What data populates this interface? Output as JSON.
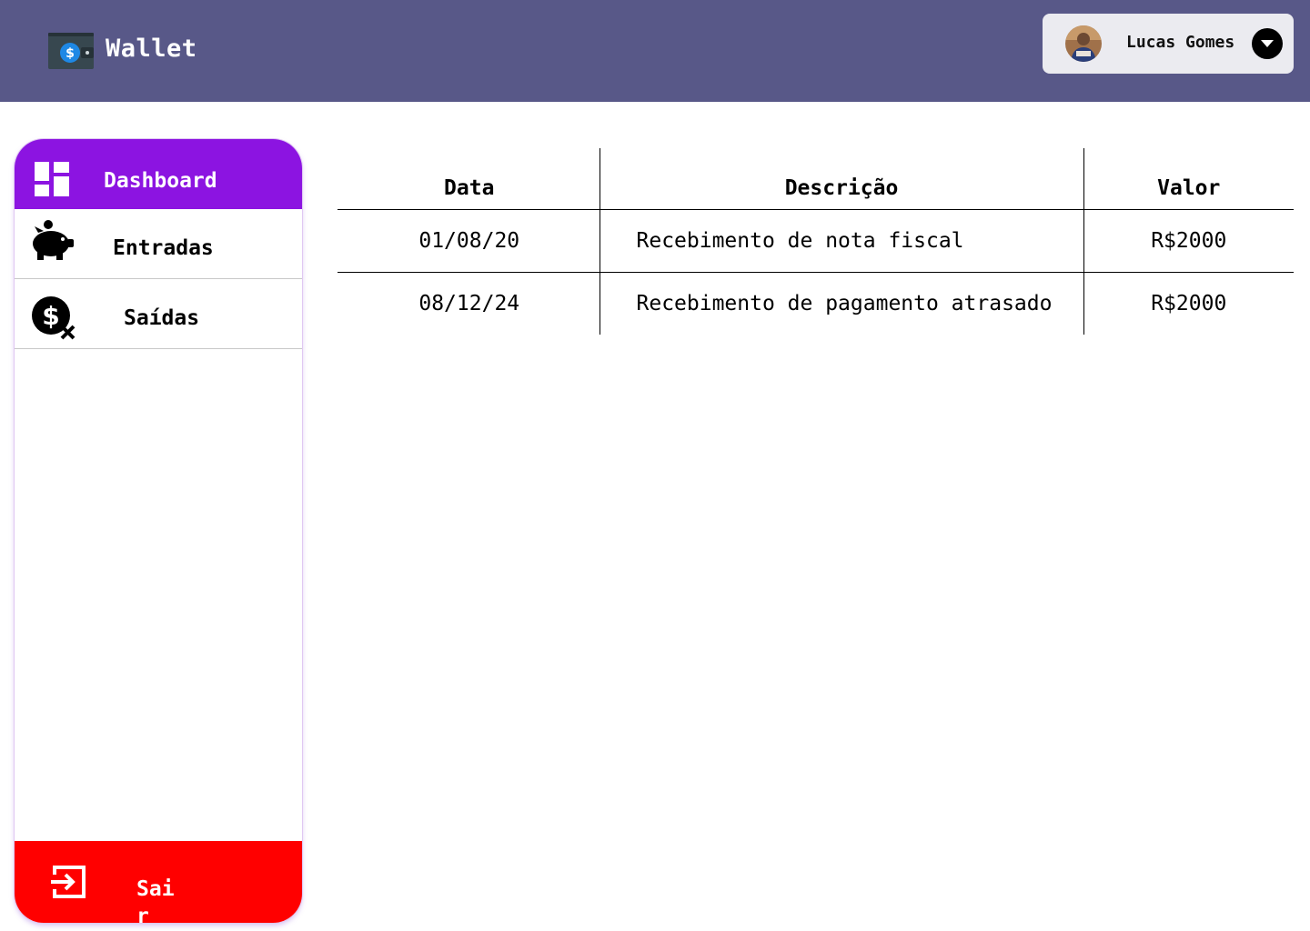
{
  "header": {
    "app_title": "Wallet",
    "logo_icon": "wallet-icon",
    "background": "#585888",
    "user": {
      "name": "Lucas Gomes",
      "avatar_icon": "user-avatar",
      "dropdown_icon": "chevron-down-icon"
    }
  },
  "sidebar": {
    "accent": "#8c14e1",
    "items": [
      {
        "label": "Dashboard",
        "icon": "dashboard-icon",
        "active": true
      },
      {
        "label": "Entradas",
        "icon": "piggy-bank-icon",
        "active": false
      },
      {
        "label": "Saídas",
        "icon": "money-off-icon",
        "active": false
      }
    ],
    "logout": {
      "label": "Sair",
      "icon": "exit-icon",
      "color": "#ff0000"
    }
  },
  "table": {
    "columns": [
      "Data",
      "Descrição",
      "Valor"
    ],
    "rows": [
      {
        "data": "01/08/20",
        "descricao": "Recebimento de nota fiscal",
        "valor": "R$2000"
      },
      {
        "data": "08/12/24",
        "descricao": "Recebimento de pagamento atrasado",
        "valor": "R$2000"
      }
    ]
  }
}
